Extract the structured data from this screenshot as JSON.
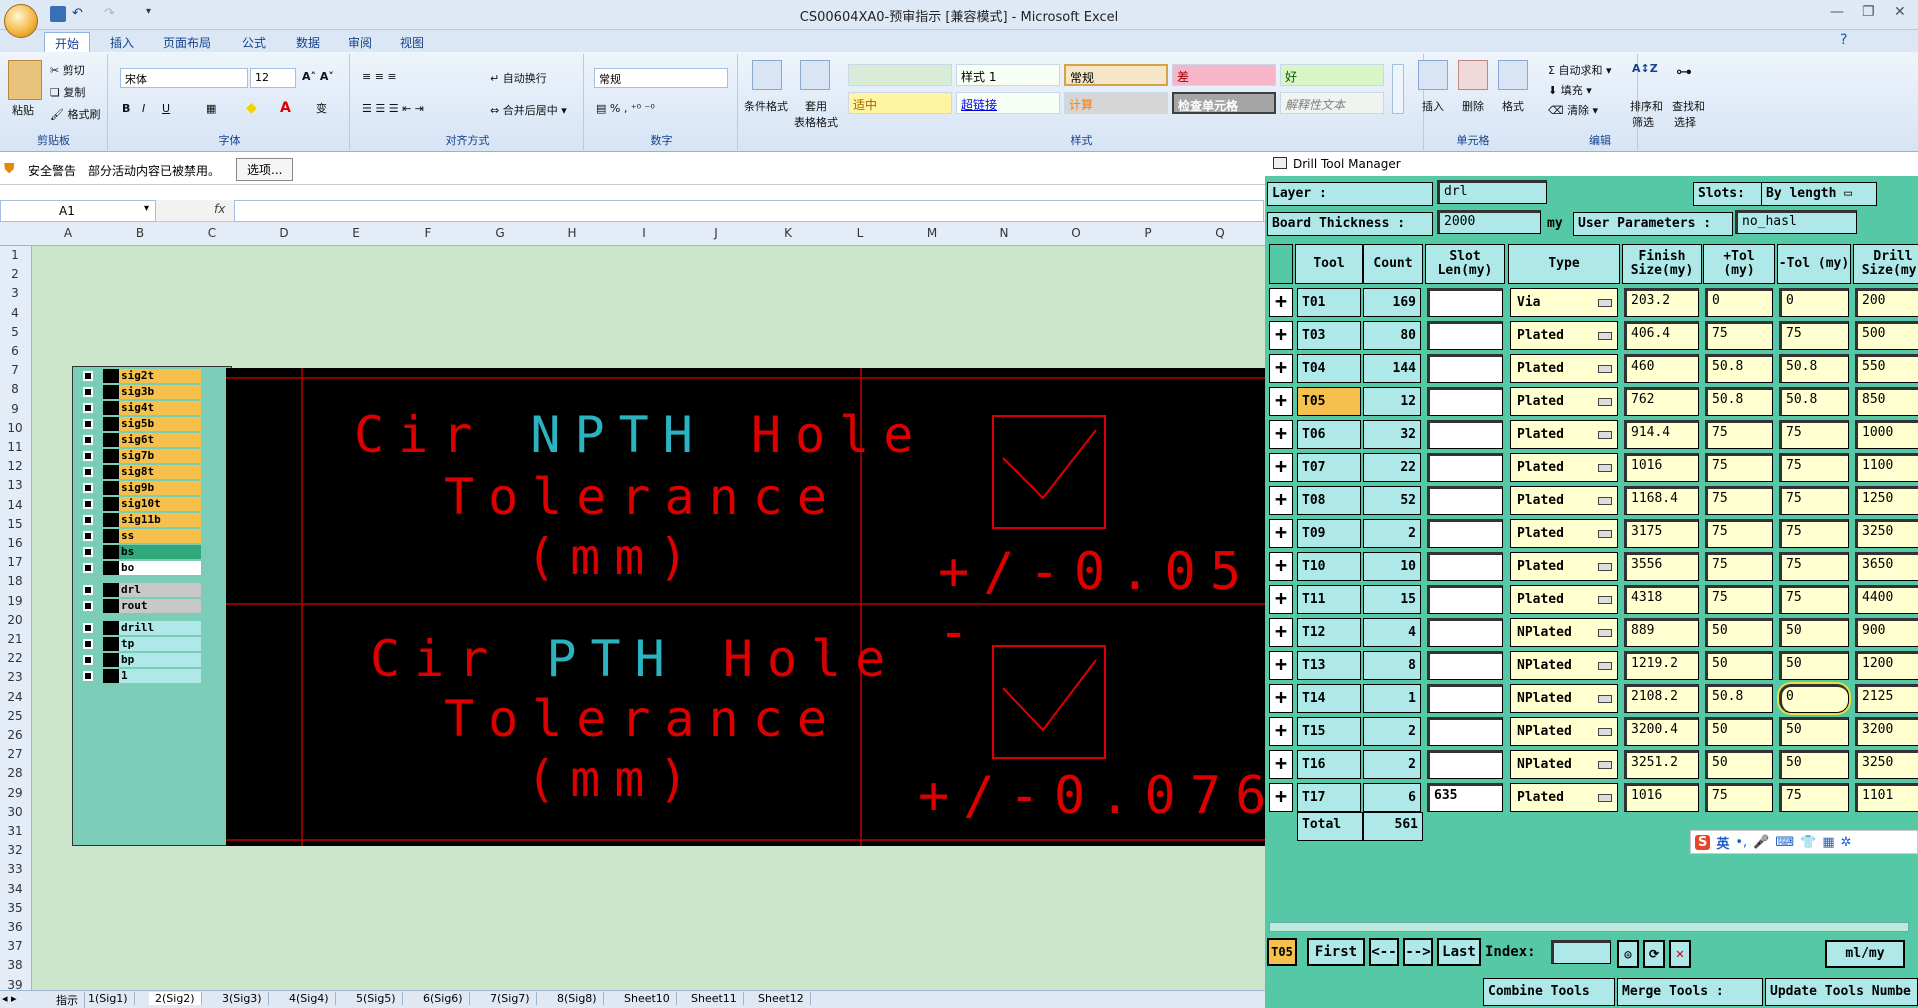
{
  "window": {
    "title": "CS00604XA0-预审指示  [兼容模式] - Microsoft Excel"
  },
  "ribbon_tabs": [
    "开始",
    "插入",
    "页面布局",
    "公式",
    "数据",
    "审阅",
    "视图"
  ],
  "ribbon": {
    "clipboard": {
      "label": "剪贴板",
      "paste": "粘贴",
      "cut": "剪切",
      "copy": "复制",
      "format_painter": "格式刷"
    },
    "font": {
      "label": "字体",
      "name": "宋体",
      "size": "12"
    },
    "alignment": {
      "label": "对齐方式",
      "wrap": "自动换行",
      "merge": "合并后居中"
    },
    "number": {
      "label": "数字",
      "format": "常规"
    },
    "styles": {
      "label": "样式",
      "conditional": "条件格式",
      "table_l1": "套用",
      "table_l2": "表格格式",
      "cells": [
        "样式 1",
        "常规",
        "差",
        "好",
        "适中",
        "超链接",
        "计算",
        "检查单元格",
        "解释性文本"
      ]
    },
    "cells_group": {
      "label": "单元格",
      "insert": "插入",
      "delete": "删除",
      "format": "格式"
    },
    "editing": {
      "label": "编辑",
      "autosum": "自动求和",
      "fill": "填充",
      "clear": "清除",
      "sort_l1": "排序和",
      "sort_l2": "筛选",
      "find_l1": "查找和",
      "find_l2": "选择"
    }
  },
  "security": {
    "label": "安全警告",
    "message": "部分活动内容已被禁用。",
    "options": "选项..."
  },
  "formula_bar": {
    "namebox": "A1",
    "fx": "fx"
  },
  "columns": [
    "A",
    "B",
    "C",
    "D",
    "E",
    "F",
    "G",
    "H",
    "I",
    "J",
    "K",
    "L",
    "M",
    "N",
    "O",
    "P",
    "Q"
  ],
  "rows": [
    "1",
    "2",
    "3",
    "4",
    "5",
    "6",
    "7",
    "8",
    "9",
    "10",
    "11",
    "12",
    "13",
    "14",
    "15",
    "16",
    "17",
    "18",
    "19",
    "20",
    "21",
    "22",
    "23",
    "24",
    "25",
    "26",
    "27",
    "28",
    "29",
    "30",
    "31",
    "32",
    "33",
    "34",
    "35",
    "36",
    "37",
    "38",
    "39"
  ],
  "layers": [
    {
      "name": "sig2t",
      "color": "#f6c04e"
    },
    {
      "name": "sig3b",
      "color": "#f6c04e"
    },
    {
      "name": "sig4t",
      "color": "#f6c04e"
    },
    {
      "name": "sig5b",
      "color": "#f6c04e"
    },
    {
      "name": "sig6t",
      "color": "#f6c04e"
    },
    {
      "name": "sig7b",
      "color": "#f6c04e"
    },
    {
      "name": "sig8t",
      "color": "#f6c04e"
    },
    {
      "name": "sig9b",
      "color": "#f6c04e"
    },
    {
      "name": "sig10t",
      "color": "#f6c04e"
    },
    {
      "name": "sig11b",
      "color": "#f6c04e"
    },
    {
      "name": "ss",
      "color": "#f6c04e"
    },
    {
      "name": "bs",
      "color": "#2fa87a"
    },
    {
      "name": "bo",
      "color": "#ffffff"
    },
    {
      "name": "drl",
      "color": "#c8c8c8"
    },
    {
      "name": "rout",
      "color": "#c8c8c8"
    },
    {
      "name": "drill",
      "color": "#aee8e8"
    },
    {
      "name": "tp",
      "color": "#aee8e8"
    },
    {
      "name": "bp",
      "color": "#aee8e8"
    },
    {
      "name": "1",
      "color": "#aee8e8"
    }
  ],
  "cad": {
    "npth_l1a": "Cir ",
    "npth_l1b": "NPTH",
    "npth_l1c": " Hole",
    "npth_l2": "Tolerance",
    "npth_l3": "(mm)",
    "npth_tol": "+/-0.05 -",
    "pth_l1a": "Cir ",
    "pth_l1b": "PTH",
    "pth_l1c": " Hole",
    "pth_l2": "Tolerance",
    "pth_l3": "(mm)",
    "pth_tol": "+/-0.076"
  },
  "dtm": {
    "title": "Drill Tool Manager",
    "layer_label": "Layer           :",
    "layer_value": "drl",
    "slots_label": "Slots:",
    "slots_value": "By length",
    "thickness_label": "Board Thickness :",
    "thickness_value": "2000",
    "thickness_unit": "my",
    "userparams_label": "User Parameters :",
    "userparams_value": "no_hasl",
    "headers": {
      "tool": "Tool",
      "count": "Count",
      "slot": "Slot Len(my)",
      "type": "Type",
      "finish": "Finish Size(my)",
      "ptol": "+Tol (my)",
      "ntol": "-Tol (my)",
      "drill": "Drill Size(my)"
    },
    "rows": [
      {
        "tool": "T01",
        "count": "169",
        "slot": "",
        "type": "Via",
        "finish": "203.2",
        "ptol": "0",
        "ntol": "0",
        "drill": "200"
      },
      {
        "tool": "T03",
        "count": "80",
        "slot": "",
        "type": "Plated",
        "finish": "406.4",
        "ptol": "75",
        "ntol": "75",
        "drill": "500"
      },
      {
        "tool": "T04",
        "count": "144",
        "slot": "",
        "type": "Plated",
        "finish": "460",
        "ptol": "50.8",
        "ntol": "50.8",
        "drill": "550"
      },
      {
        "tool": "T05",
        "count": "12",
        "slot": "",
        "type": "Plated",
        "finish": "762",
        "ptol": "50.8",
        "ntol": "50.8",
        "drill": "850"
      },
      {
        "tool": "T06",
        "count": "32",
        "slot": "",
        "type": "Plated",
        "finish": "914.4",
        "ptol": "75",
        "ntol": "75",
        "drill": "1000"
      },
      {
        "tool": "T07",
        "count": "22",
        "slot": "",
        "type": "Plated",
        "finish": "1016",
        "ptol": "75",
        "ntol": "75",
        "drill": "1100"
      },
      {
        "tool": "T08",
        "count": "52",
        "slot": "",
        "type": "Plated",
        "finish": "1168.4",
        "ptol": "75",
        "ntol": "75",
        "drill": "1250"
      },
      {
        "tool": "T09",
        "count": "2",
        "slot": "",
        "type": "Plated",
        "finish": "3175",
        "ptol": "75",
        "ntol": "75",
        "drill": "3250"
      },
      {
        "tool": "T10",
        "count": "10",
        "slot": "",
        "type": "Plated",
        "finish": "3556",
        "ptol": "75",
        "ntol": "75",
        "drill": "3650"
      },
      {
        "tool": "T11",
        "count": "15",
        "slot": "",
        "type": "Plated",
        "finish": "4318",
        "ptol": "75",
        "ntol": "75",
        "drill": "4400"
      },
      {
        "tool": "T12",
        "count": "4",
        "slot": "",
        "type": "NPlated",
        "finish": "889",
        "ptol": "50",
        "ntol": "50",
        "drill": "900"
      },
      {
        "tool": "T13",
        "count": "8",
        "slot": "",
        "type": "NPlated",
        "finish": "1219.2",
        "ptol": "50",
        "ntol": "50",
        "drill": "1200"
      },
      {
        "tool": "T14",
        "count": "1",
        "slot": "",
        "type": "NPlated",
        "finish": "2108.2",
        "ptol": "50.8",
        "ntol": "0",
        "drill": "2125"
      },
      {
        "tool": "T15",
        "count": "2",
        "slot": "",
        "type": "NPlated",
        "finish": "3200.4",
        "ptol": "50",
        "ntol": "50",
        "drill": "3200"
      },
      {
        "tool": "T16",
        "count": "2",
        "slot": "",
        "type": "NPlated",
        "finish": "3251.2",
        "ptol": "50",
        "ntol": "50",
        "drill": "3250"
      },
      {
        "tool": "T17",
        "count": "6",
        "slot": "635",
        "type": "Plated",
        "finish": "1016",
        "ptol": "75",
        "ntol": "75",
        "drill": "1101"
      }
    ],
    "total_label": "Total",
    "total_count": "561",
    "current_tool": "T05",
    "nav": {
      "first": "First",
      "prev": "<--",
      "next": "-->",
      "last": "Last",
      "index": "Index:",
      "units": "ml/my"
    },
    "bottom": {
      "combine": "Combine Tools",
      "merge": "Merge Tools :",
      "update": "Update Tools Numbe"
    }
  },
  "ime": {
    "label": "英"
  },
  "sheet_tabs": [
    "指示",
    "1(Sig1)",
    "2(Sig2)",
    "3(Sig3)",
    "4(Sig4)",
    "5(Sig5)",
    "6(Sig6)",
    "7(Sig7)",
    "8(Sig8)",
    "Sheet10",
    "Sheet11",
    "Sheet12"
  ]
}
